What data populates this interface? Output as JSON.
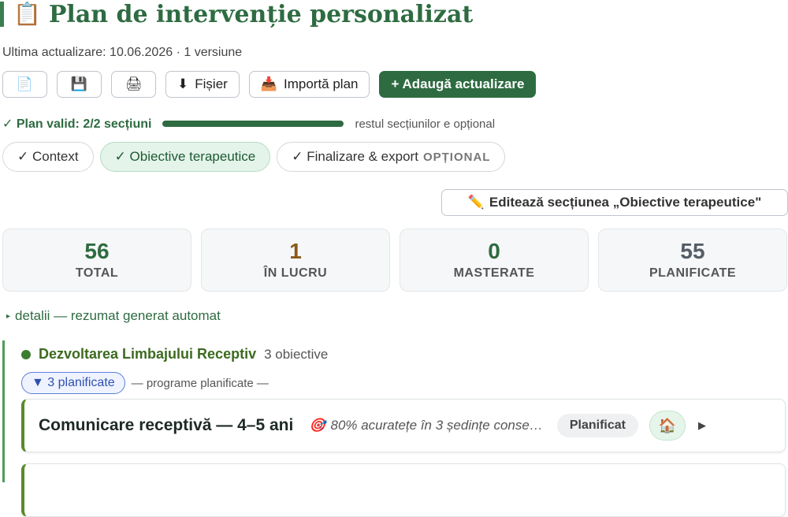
{
  "header": {
    "icon": "📋",
    "title": "Plan de intervenție personalizat",
    "meta": "Ultima actualizare: 10.06.2026 · 1 versiune"
  },
  "toolbar": {
    "new_icon": "📄",
    "save_icon": "💾",
    "print_icon": "🖨",
    "file_icon": "⬇",
    "file_label": "Fișier",
    "import_icon": "📥",
    "import_label": "Importă plan",
    "add_label": "+ Adaugă actualizare"
  },
  "validation": {
    "status": "✓ Plan valid: 2/2 secțiuni",
    "progress_fraction": 1.0,
    "note": "restul secțiunilor e opțional"
  },
  "tabs": [
    {
      "label": "✓ Context",
      "active": false
    },
    {
      "label": "✓ Obiective terapeutice",
      "active": true
    },
    {
      "label": "✓ Finalizare & export",
      "optional": "OPȚIONAL",
      "active": false
    }
  ],
  "edit_section": {
    "icon": "✏️",
    "label": "Editează secțiunea „Obiective terapeutice\""
  },
  "stats": [
    {
      "value": "56",
      "label": "TOTAL",
      "color": "#2e6b41"
    },
    {
      "value": "1",
      "label": "ÎN LUCRU",
      "color": "#8a5a1a"
    },
    {
      "value": "0",
      "label": "MASTERATE",
      "color": "#2e6b41"
    },
    {
      "value": "55",
      "label": "PLANIFICATE",
      "color": "#555d66"
    }
  ],
  "details_label": "detalii — rezumat generat automat",
  "group": {
    "name": "Dezvoltarea Limbajului Receptiv",
    "count": "3 obiective",
    "filter_pill": "▼ 3 planificate",
    "filter_note": "— programe planificate —",
    "items": [
      {
        "title": "Comunicare receptivă — 4–5 ani",
        "target_icon": "🎯",
        "target": "80% acuratețe în 3 ședințe conse…",
        "status": "Planificat",
        "home_icon": "🏠"
      }
    ]
  },
  "colors": {
    "brand": "#2e6b41",
    "accent_green": "#4f9a5a",
    "filter_blue": "#2f4fb0"
  }
}
